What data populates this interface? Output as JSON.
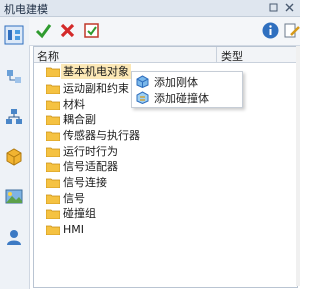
{
  "window": {
    "title": "机电建模"
  },
  "tree": {
    "columns": {
      "name": "名称",
      "type": "类型"
    },
    "items": [
      {
        "label": "基本机电对象",
        "selected": true
      },
      {
        "label": "运动副和约束"
      },
      {
        "label": "材料"
      },
      {
        "label": "耦合副"
      },
      {
        "label": "传感器与执行器"
      },
      {
        "label": "运行时行为"
      },
      {
        "label": "信号适配器"
      },
      {
        "label": "信号连接"
      },
      {
        "label": "信号"
      },
      {
        "label": "碰撞组"
      },
      {
        "label": "HMI"
      }
    ]
  },
  "context_menu": {
    "items": [
      {
        "label": "添加刚体",
        "icon": "rigid-body-icon"
      },
      {
        "label": "添加碰撞体",
        "icon": "collision-body-icon"
      }
    ]
  },
  "colors": {
    "accent": "#2f6fbf",
    "selection": "#fce8b6",
    "folder": "#f5c242"
  }
}
